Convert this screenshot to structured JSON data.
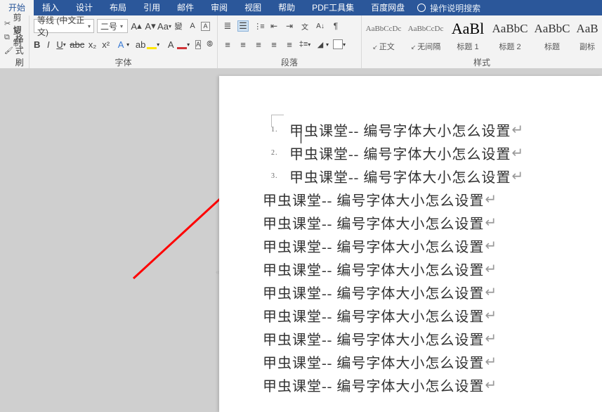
{
  "tabs": {
    "home": "开始",
    "insert": "插入",
    "design": "设计",
    "layout": "布局",
    "references": "引用",
    "mailings": "邮件",
    "review": "审阅",
    "view": "视图",
    "help": "帮助",
    "pdf_tools": "PDF工具集",
    "baidu_netdisk": "百度网盘",
    "tell_me": "操作说明搜索"
  },
  "clipboard": {
    "cut": "剪切",
    "copy": "复制",
    "format_painter": "格式刷"
  },
  "font": {
    "name": "等线 (中文正文)",
    "size": "二号",
    "group_label": "字体"
  },
  "paragraph": {
    "group_label": "段落"
  },
  "styles": {
    "group_label": "样式",
    "items": [
      {
        "preview": "AaBbCcDc",
        "name": "正文",
        "checked": true
      },
      {
        "preview": "AaBbCcDc",
        "name": "无间隔",
        "checked": true
      },
      {
        "preview": "AaBl",
        "name": "标题 1",
        "checked": false
      },
      {
        "preview": "AaBbC",
        "name": "标题 2",
        "checked": false
      },
      {
        "preview": "AaBbC",
        "name": "标题",
        "checked": false
      },
      {
        "preview": "AaB",
        "name": "副标",
        "checked": false
      }
    ]
  },
  "document": {
    "numbered_lines": [
      {
        "n": "1.",
        "text": "甲虫课堂-- 编号字体大小怎么设置"
      },
      {
        "n": "2.",
        "text": "甲虫课堂-- 编号字体大小怎么设置"
      },
      {
        "n": "3.",
        "text": "甲虫课堂-- 编号字体大小怎么设置"
      }
    ],
    "plain_lines": [
      "甲虫课堂-- 编号字体大小怎么设置",
      "甲虫课堂-- 编号字体大小怎么设置",
      "甲虫课堂-- 编号字体大小怎么设置",
      "甲虫课堂-- 编号字体大小怎么设置",
      "甲虫课堂-- 编号字体大小怎么设置",
      "甲虫课堂-- 编号字体大小怎么设置",
      "甲虫课堂-- 编号字体大小怎么设置",
      "甲虫课堂-- 编号字体大小怎么设置",
      "甲虫课堂-- 编号字体大小怎么设置"
    ],
    "return_mark": "↵"
  },
  "annotation": {
    "arrow_color": "#ff0000"
  }
}
